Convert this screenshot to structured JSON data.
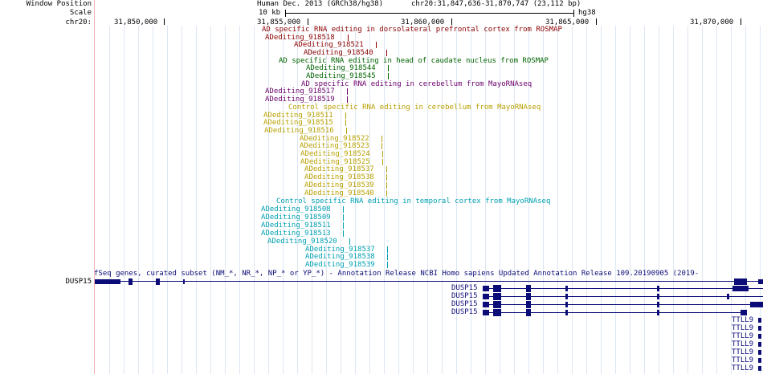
{
  "left_labels": {
    "window_position": "Window Position",
    "scale": "Scale",
    "chrom": "chr20:",
    "gene": "DUSP15"
  },
  "header": {
    "assembly": "Human Dec. 2013 (GRCh38/hg38)",
    "position": "chr20:31,847,636-31,870,747 (23,112 bp)",
    "scale_text": "10 kb",
    "scale_right": "hg38"
  },
  "ruler": {
    "ticks": [
      "31,850,000",
      "31,855,000",
      "31,860,000",
      "31,865,000",
      "31,870,000"
    ]
  },
  "tracks": {
    "dlpfc": {
      "title": "AD specific RNA editing in dorsolateral prefrontal cortex from ROSMAP",
      "color": "#8b0000",
      "items": [
        "ADediting_918518",
        "ADediting_918521",
        "ADediting_918540"
      ]
    },
    "caudate": {
      "title": "AD specific RNA editing in head of caudate nucleus from ROSMAP",
      "color": "#006400",
      "items": [
        "ADediting_918544",
        "ADediting_918545"
      ]
    },
    "cereb_ad": {
      "title": "AD specific RNA editing in cerebellum from MayoRNAseq",
      "color": "#6a006a",
      "items": [
        "ADediting_918517",
        "ADediting_918519"
      ]
    },
    "cereb_ctrl": {
      "title": "Control specific RNA editing in cerebellum from MayoRNAseq",
      "color": "#b8a000",
      "items": [
        "ADediting_918511",
        "ADediting_918515",
        "ADediting_918516",
        "ADediting_918522",
        "ADediting_918523",
        "ADediting_918524",
        "ADediting_918525",
        "ADediting_918537",
        "ADediting_918538",
        "ADediting_918539",
        "ADediting_918540"
      ]
    },
    "temporal_ctrl": {
      "title": "Control specific RNA editing in temporal cortex from MayoRNAseq",
      "color": "#00a0b0",
      "items": [
        "ADediting_918508",
        "ADediting_918509",
        "ADediting_918511",
        "ADediting_918513",
        "ADediting_918520",
        "ADediting_918537",
        "ADediting_918538",
        "ADediting_918539"
      ]
    }
  },
  "genes_track": {
    "title": "fSeq genes, curated subset (NM_*, NR_*, NP_* or YP_*) - Annotation Release NCBI Homo sapiens Updated Annotation Release 109.20190905 (2019-",
    "color": "#0c0c78",
    "dusp15_labels": [
      "DUSP15",
      "DUSP15",
      "DUSP15",
      "DUSP15"
    ],
    "ttll9_labels": [
      "TTLL9",
      "TTLL9",
      "TTLL9",
      "TTLL9",
      "TTLL9",
      "TTLL9",
      "TTLL9"
    ]
  }
}
